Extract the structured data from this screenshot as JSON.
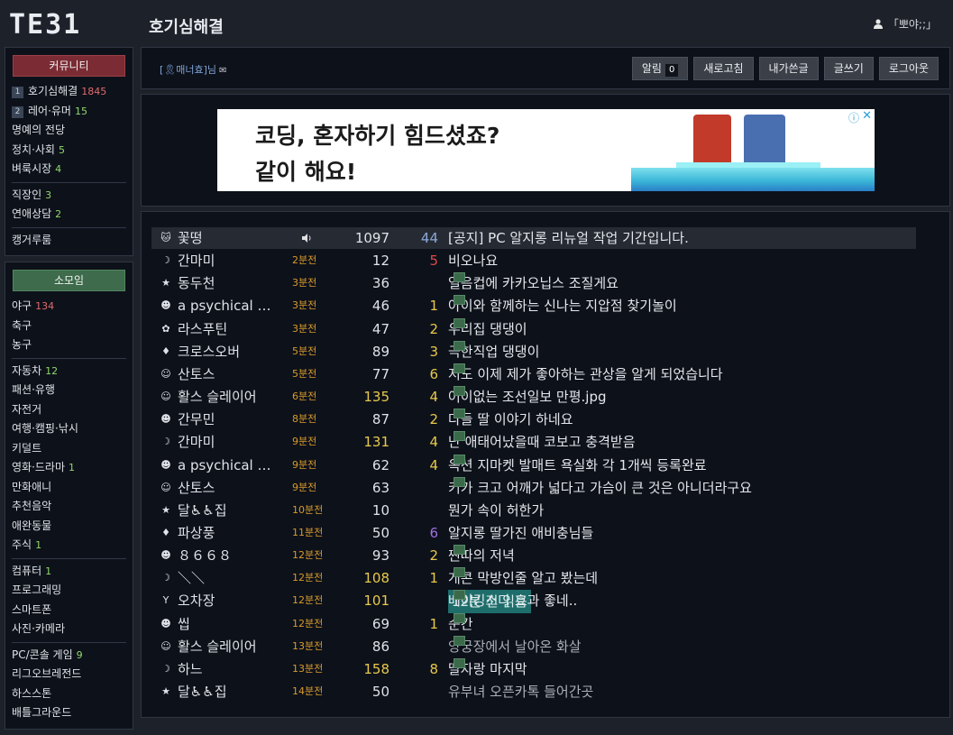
{
  "logo": "TE31",
  "board_title": "호기심해결",
  "user": "「뽀야;;」",
  "sidebar": {
    "community_head": "커뮤니티",
    "community": [
      {
        "num": "1",
        "label": "호기심해결",
        "count": "1845",
        "count_color": "red"
      },
      {
        "num": "2",
        "label": "레어·유머",
        "count": "15",
        "count_color": "green"
      },
      {
        "num": "",
        "label": "명예의 전당",
        "count": "",
        "count_color": ""
      },
      {
        "num": "",
        "label": "정치·사회",
        "count": "5",
        "count_color": "green"
      },
      {
        "num": "",
        "label": "벼룩시장",
        "count": "4",
        "count_color": "green"
      },
      {
        "sep": true
      },
      {
        "num": "",
        "label": "직장인",
        "count": "3",
        "count_color": "green"
      },
      {
        "num": "",
        "label": "연애상담",
        "count": "2",
        "count_color": "green"
      },
      {
        "sep": true
      },
      {
        "num": "",
        "label": "캥거루룸",
        "count": "",
        "count_color": ""
      }
    ],
    "small_head": "소모임",
    "small": [
      {
        "label": "야구",
        "count": "134",
        "count_color": "red"
      },
      {
        "label": "축구",
        "count": "",
        "count_color": ""
      },
      {
        "label": "농구",
        "count": "",
        "count_color": ""
      },
      {
        "sep": true
      },
      {
        "label": "자동차",
        "count": "12",
        "count_color": "green"
      },
      {
        "label": "패션·유행",
        "count": "",
        "count_color": ""
      },
      {
        "label": "자전거",
        "count": "",
        "count_color": ""
      },
      {
        "label": "여행·캠핑·낚시",
        "count": "",
        "count_color": ""
      },
      {
        "label": "키덜트",
        "count": "",
        "count_color": ""
      },
      {
        "label": "영화·드라마",
        "count": "1",
        "count_color": "green"
      },
      {
        "label": "만화애니",
        "count": "",
        "count_color": ""
      },
      {
        "label": "추천음악",
        "count": "",
        "count_color": ""
      },
      {
        "label": "애완동물",
        "count": "",
        "count_color": ""
      },
      {
        "label": "주식",
        "count": "1",
        "count_color": "green"
      },
      {
        "sep": true
      },
      {
        "label": "컴퓨터",
        "count": "1",
        "count_color": "green"
      },
      {
        "label": "프로그래밍",
        "count": "",
        "count_color": ""
      },
      {
        "label": "스마트폰",
        "count": "",
        "count_color": ""
      },
      {
        "label": "사진·카메라",
        "count": "",
        "count_color": ""
      },
      {
        "sep": true
      },
      {
        "label": "PC/콘솔 게임",
        "count": "9",
        "count_color": "green"
      },
      {
        "label": "리그오브레전드",
        "count": "",
        "count_color": ""
      },
      {
        "label": "하스스톤",
        "count": "",
        "count_color": ""
      },
      {
        "label": "배틀그라운드",
        "count": "",
        "count_color": ""
      }
    ]
  },
  "toolbar": {
    "manner": "[🎗매너효]님",
    "mail": "✉",
    "buttons": [
      {
        "name": "alarm-button",
        "label": "알림",
        "badge": "0"
      },
      {
        "name": "refresh-button",
        "label": "새로고침"
      },
      {
        "name": "my-posts-button",
        "label": "내가쓴글"
      },
      {
        "name": "write-button",
        "label": "글쓰기"
      },
      {
        "name": "logout-button",
        "label": "로그아웃"
      }
    ]
  },
  "ad": {
    "line1": "코딩, 혼자하기 힘드셨죠?",
    "line2": "같이 해요!",
    "info": "ⓘ",
    "close": "✕"
  },
  "posts": [
    {
      "icon": "🐱",
      "nick": "꽃떵",
      "time": "",
      "views": "1097",
      "views_color": "",
      "comments": "44",
      "comments_color": "b",
      "title": "[공지] PC 알지롱 리뉴얼 작업 기간입니다.",
      "img": false,
      "notice": true,
      "read_tag": ""
    },
    {
      "icon": "☽",
      "nick": "간마미",
      "time": "2분전",
      "views": "12",
      "views_color": "",
      "comments": "5",
      "comments_color": "r",
      "title": "비오나요",
      "img": false,
      "notice": false,
      "read_tag": ""
    },
    {
      "icon": "★",
      "nick": "동두천",
      "time": "3분전",
      "views": "36",
      "views_color": "",
      "comments": "",
      "comments_color": "",
      "title": "얼음컵에 카카오닙스 조질게요",
      "img": true,
      "notice": false,
      "read_tag": ""
    },
    {
      "icon": "☻",
      "nick": "a psychical …",
      "time": "3분전",
      "views": "46",
      "views_color": "",
      "comments": "1",
      "comments_color": "y",
      "title": "아이와 함께하는 신나는 지압점 찾기놀이",
      "img": true,
      "notice": false,
      "read_tag": ""
    },
    {
      "icon": "✿",
      "nick": "라스푸틴",
      "time": "3분전",
      "views": "47",
      "views_color": "",
      "comments": "2",
      "comments_color": "y",
      "title": "우리집 댕댕이",
      "img": true,
      "notice": false,
      "read_tag": ""
    },
    {
      "icon": "♦",
      "nick": "크로스오버",
      "time": "5분전",
      "views": "89",
      "views_color": "",
      "comments": "3",
      "comments_color": "y",
      "title": "극한직업 댕댕이",
      "img": true,
      "notice": false,
      "read_tag": ""
    },
    {
      "icon": "☺",
      "nick": "산토스",
      "time": "5분전",
      "views": "77",
      "views_color": "",
      "comments": "6",
      "comments_color": "y",
      "title": "저도 이제 제가 좋아하는 관상을 알게 되었습니다",
      "img": true,
      "notice": false,
      "read_tag": ""
    },
    {
      "icon": "☺",
      "nick": "활스 슬레이어",
      "time": "6분전",
      "views": "135",
      "views_color": "y",
      "comments": "4",
      "comments_color": "y",
      "title": "어이없는 조선일보 만평.jpg",
      "img": true,
      "notice": false,
      "read_tag": ""
    },
    {
      "icon": "☻",
      "nick": "간무민",
      "time": "8분전",
      "views": "87",
      "views_color": "",
      "comments": "2",
      "comments_color": "y",
      "title": "다들 딸 이야기 하네요",
      "img": true,
      "notice": false,
      "read_tag": ""
    },
    {
      "icon": "☽",
      "nick": "간마미",
      "time": "9분전",
      "views": "131",
      "views_color": "y",
      "comments": "4",
      "comments_color": "y",
      "title": "난 애태어났을때 코보고 충격받음",
      "img": true,
      "notice": false,
      "read_tag": ""
    },
    {
      "icon": "☻",
      "nick": "a psychical …",
      "time": "9분전",
      "views": "62",
      "views_color": "",
      "comments": "4",
      "comments_color": "y",
      "title": "옥션 지마켓 발매트 욕실화 각 1개씩 등록완료",
      "img": true,
      "notice": false,
      "read_tag": ""
    },
    {
      "icon": "☺",
      "nick": "산토스",
      "time": "9분전",
      "views": "63",
      "views_color": "",
      "comments": "",
      "comments_color": "",
      "title": "키가 크고 어깨가 넓다고 가슴이 큰 것은 아니더라구요",
      "img": true,
      "notice": false,
      "read_tag": ""
    },
    {
      "icon": "★",
      "nick": "달♿♿집",
      "time": "10분전",
      "views": "10",
      "views_color": "",
      "comments": "",
      "comments_color": "",
      "title": "뭔가 속이 허한가",
      "img": false,
      "notice": false,
      "read_tag": ""
    },
    {
      "icon": "♦",
      "nick": "파상풍",
      "time": "11분전",
      "views": "50",
      "views_color": "",
      "comments": "6",
      "comments_color": "p",
      "title": "알지롱 딸가진 애비충님들",
      "img": false,
      "notice": false,
      "read_tag": ""
    },
    {
      "icon": "☻",
      "nick": "８６６８",
      "time": "12분전",
      "views": "93",
      "views_color": "",
      "comments": "2",
      "comments_color": "y",
      "title": "찐따의 저녁",
      "img": true,
      "notice": false,
      "read_tag": ""
    },
    {
      "icon": "☽",
      "nick": "＼＼",
      "time": "12분전",
      "views": "108",
      "views_color": "y",
      "comments": "1",
      "comments_color": "y",
      "title": "개콘 막방인줄 알고 봤는데",
      "img": true,
      "notice": false,
      "read_tag": ""
    },
    {
      "icon": "Y",
      "nick": "오차장",
      "time": "12분전",
      "views": "101",
      "views_color": "y",
      "comments": "",
      "comments_color": "",
      "title": "베이킹소다 효과 좋네..",
      "img": true,
      "notice": false,
      "read_tag": "12분 전 읽음"
    },
    {
      "icon": "☻",
      "nick": "씹",
      "time": "12분전",
      "views": "69",
      "views_color": "",
      "comments": "1",
      "comments_color": "y",
      "title": "순간",
      "img": true,
      "notice": false,
      "read_tag": ""
    },
    {
      "icon": "☺",
      "nick": "활스 슬레이어",
      "time": "13분전",
      "views": "86",
      "views_color": "",
      "comments": "",
      "comments_color": "",
      "title": "양궁장에서 날아온 화살",
      "img": true,
      "notice": false,
      "read_tag": "",
      "dim": true
    },
    {
      "icon": "☽",
      "nick": "하느",
      "time": "13분전",
      "views": "158",
      "views_color": "y",
      "comments": "8",
      "comments_color": "y",
      "title": "딸자랑 마지막",
      "img": true,
      "notice": false,
      "read_tag": ""
    },
    {
      "icon": "★",
      "nick": "달♿♿집",
      "time": "14분전",
      "views": "50",
      "views_color": "",
      "comments": "",
      "comments_color": "",
      "title": "유부녀 오픈카톡 들어간곳",
      "img": false,
      "notice": false,
      "read_tag": "",
      "dim": true
    }
  ]
}
